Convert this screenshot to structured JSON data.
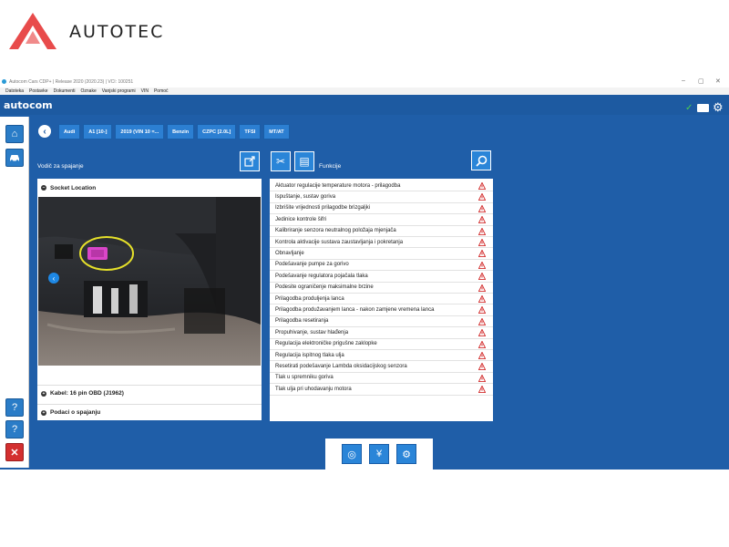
{
  "brand": {
    "name": "AUTOTEC"
  },
  "window": {
    "title": "Autocom Cars CDP+ | Release 2020 (2020.23) | VCI: 100251",
    "controls": [
      "–",
      "▢",
      "✕"
    ]
  },
  "menu": [
    "Datoteka",
    "Postavke",
    "Dokumenti",
    "Oznake",
    "Vanjski programi",
    "VIN",
    "Pomoć"
  ],
  "app": {
    "logo": "autocom",
    "status_check": "✓",
    "gear": "⚙"
  },
  "sidebar": {
    "home": "⌂",
    "car": "🚗",
    "help_a": "?",
    "help_b": "?",
    "close": "✕"
  },
  "breadcrumbs": [
    "Audi",
    "A1 [10-]",
    "2019 (VIN 10 =...",
    "Benzin",
    "CZPC [2.0L]",
    "TFSI",
    "MT/AT"
  ],
  "left_panel": {
    "title": "Vodič za spajanje",
    "section_socket": "Socket Location",
    "section_cable": "Kabel: 16 pin OBD (J1962)",
    "section_data": "Podaci o spajanju"
  },
  "right_panel": {
    "title": "Funkcije",
    "functions": [
      "Aktuator regulacije temperature motora - prilagodba",
      "Ispuštanje, sustav goriva",
      "Izbrišite vrijednosti prilagodbe brizgaljki",
      "Jedinice kontrole šifri",
      "Kalibriranje senzora neutralnog položaja mjenjača",
      "Kontrola aktivacije sustava zaustavljanja i pokretanja",
      "Obnavljanje",
      "Podešavanje pumpe za gorivo",
      "Podešavanje regulatora pojačala tlaka",
      "Podesite ograničenje maksimalne brzine",
      "Prilagodba produljenja lanca",
      "Prilagodba produžavanjem lanca - nakon zamjene vremena lanca",
      "Prilagodba resetiranja",
      "Propuhivanje, sustav hlađenja",
      "Regulacija elektroničke prigušne zaklopke",
      "Regulacija ispitnog tlaka ulja",
      "Resetirati podešavanje Lambda oksidacijskog senzora",
      "Tlak u spremniku goriva",
      "Tlak ulja pri uhodavanju motora"
    ]
  },
  "colors": {
    "app_bg": "#1f5ea8",
    "accent": "#2a85d8",
    "warning": "#d32f2f",
    "brand_red": "#e84b4b"
  }
}
